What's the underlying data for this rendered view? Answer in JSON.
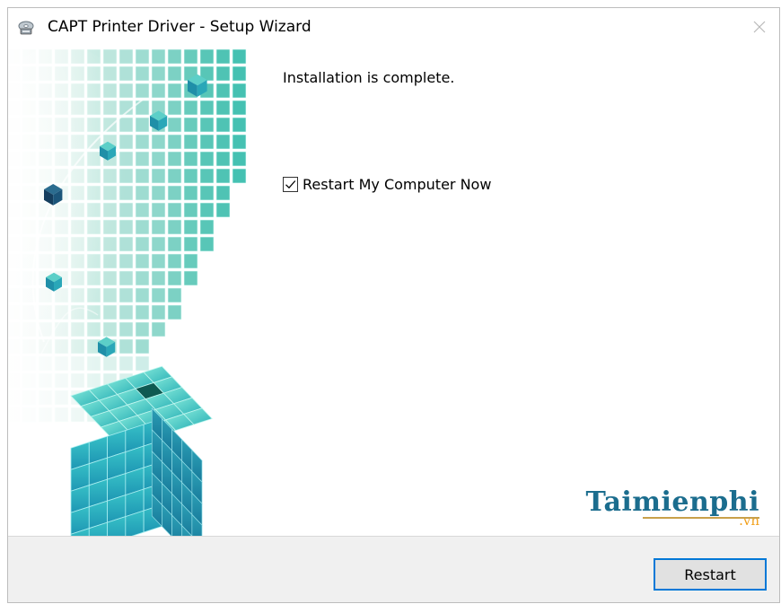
{
  "window": {
    "title": "CAPT Printer Driver - Setup Wizard",
    "icons": {
      "app": "printer-disc-icon",
      "close": "close-icon"
    }
  },
  "content": {
    "status_text": "Installation is complete.",
    "restart_checkbox": {
      "label": "Restart My Computer Now",
      "checked": true
    }
  },
  "footer": {
    "restart_button_label": "Restart"
  },
  "watermark": {
    "main": "Taimienphi",
    "sub": ".vn"
  },
  "colors": {
    "accent": "#0078d7",
    "footer_bg": "#f0f0f0",
    "cube_teal": "#3fc7c9",
    "watermark_blue": "#1b6d8e",
    "watermark_orange": "#f2a01b"
  }
}
